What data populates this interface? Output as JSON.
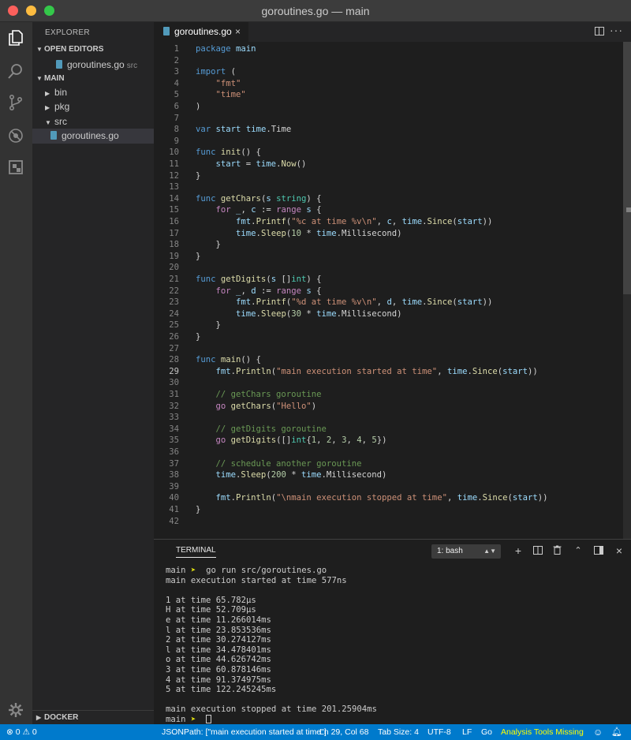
{
  "window": {
    "title": "goroutines.go — main"
  },
  "sidebar": {
    "title": "EXPLORER",
    "open_editors": {
      "label": "OPEN EDITORS",
      "items": [
        {
          "name": "goroutines.go",
          "path": "src"
        }
      ]
    },
    "main": {
      "label": "MAIN",
      "folders": [
        {
          "name": "bin",
          "expanded": false
        },
        {
          "name": "pkg",
          "expanded": false
        },
        {
          "name": "src",
          "expanded": true
        }
      ],
      "file": "goroutines.go"
    },
    "docker": "DOCKER"
  },
  "editor": {
    "tab_label": "goroutines.go",
    "tab_close": "×",
    "active_line": 29,
    "lines": [
      "package main",
      "",
      "import (",
      "    \"fmt\"",
      "    \"time\"",
      ")",
      "",
      "var start time.Time",
      "",
      "func init() {",
      "    start = time.Now()",
      "}",
      "",
      "func getChars(s string) {",
      "    for _, c := range s {",
      "        fmt.Printf(\"%c at time %v\\n\", c, time.Since(start))",
      "        time.Sleep(10 * time.Millisecond)",
      "    }",
      "}",
      "",
      "func getDigits(s []int) {",
      "    for _, d := range s {",
      "        fmt.Printf(\"%d at time %v\\n\", d, time.Since(start))",
      "        time.Sleep(30 * time.Millisecond)",
      "    }",
      "}",
      "",
      "func main() {",
      "    fmt.Println(\"main execution started at time\", time.Since(start))",
      "",
      "    // getChars goroutine",
      "    go getChars(\"Hello\")",
      "",
      "    // getDigits goroutine",
      "    go getDigits([]int{1, 2, 3, 4, 5})",
      "",
      "    // schedule another goroutine",
      "    time.Sleep(200 * time.Millisecond)",
      "",
      "    fmt.Println(\"\\nmain execution stopped at time\", time.Since(start))",
      "}",
      ""
    ]
  },
  "panel": {
    "title": "TERMINAL",
    "terminal_select": "1: bash",
    "command": "go run src/goroutines.go",
    "prompt_dir": "main",
    "prompt_arrow": "➤",
    "output": [
      "main execution started at time 577ns",
      "",
      "1 at time 65.782µs",
      "H at time 52.709µs",
      "e at time 11.266014ms",
      "l at time 23.853536ms",
      "2 at time 30.274127ms",
      "l at time 34.478401ms",
      "o at time 44.626742ms",
      "3 at time 60.878146ms",
      "4 at time 91.374975ms",
      "5 at time 122.245245ms",
      "",
      "main execution stopped at time 201.25904ms"
    ]
  },
  "statusbar": {
    "errors": "0",
    "warnings": "0",
    "jsonpath": "JSONPath: [\"main execution started at time\"]",
    "position": "Ln 29, Col 68",
    "tab_size": "Tab Size: 4",
    "encoding": "UTF-8",
    "eol": "LF",
    "language": "Go",
    "analysis": "Analysis Tools Missing"
  },
  "colors": {
    "accent": "#007acc",
    "warning_text": "#ffff00",
    "go_file_icon": "#519aba"
  }
}
